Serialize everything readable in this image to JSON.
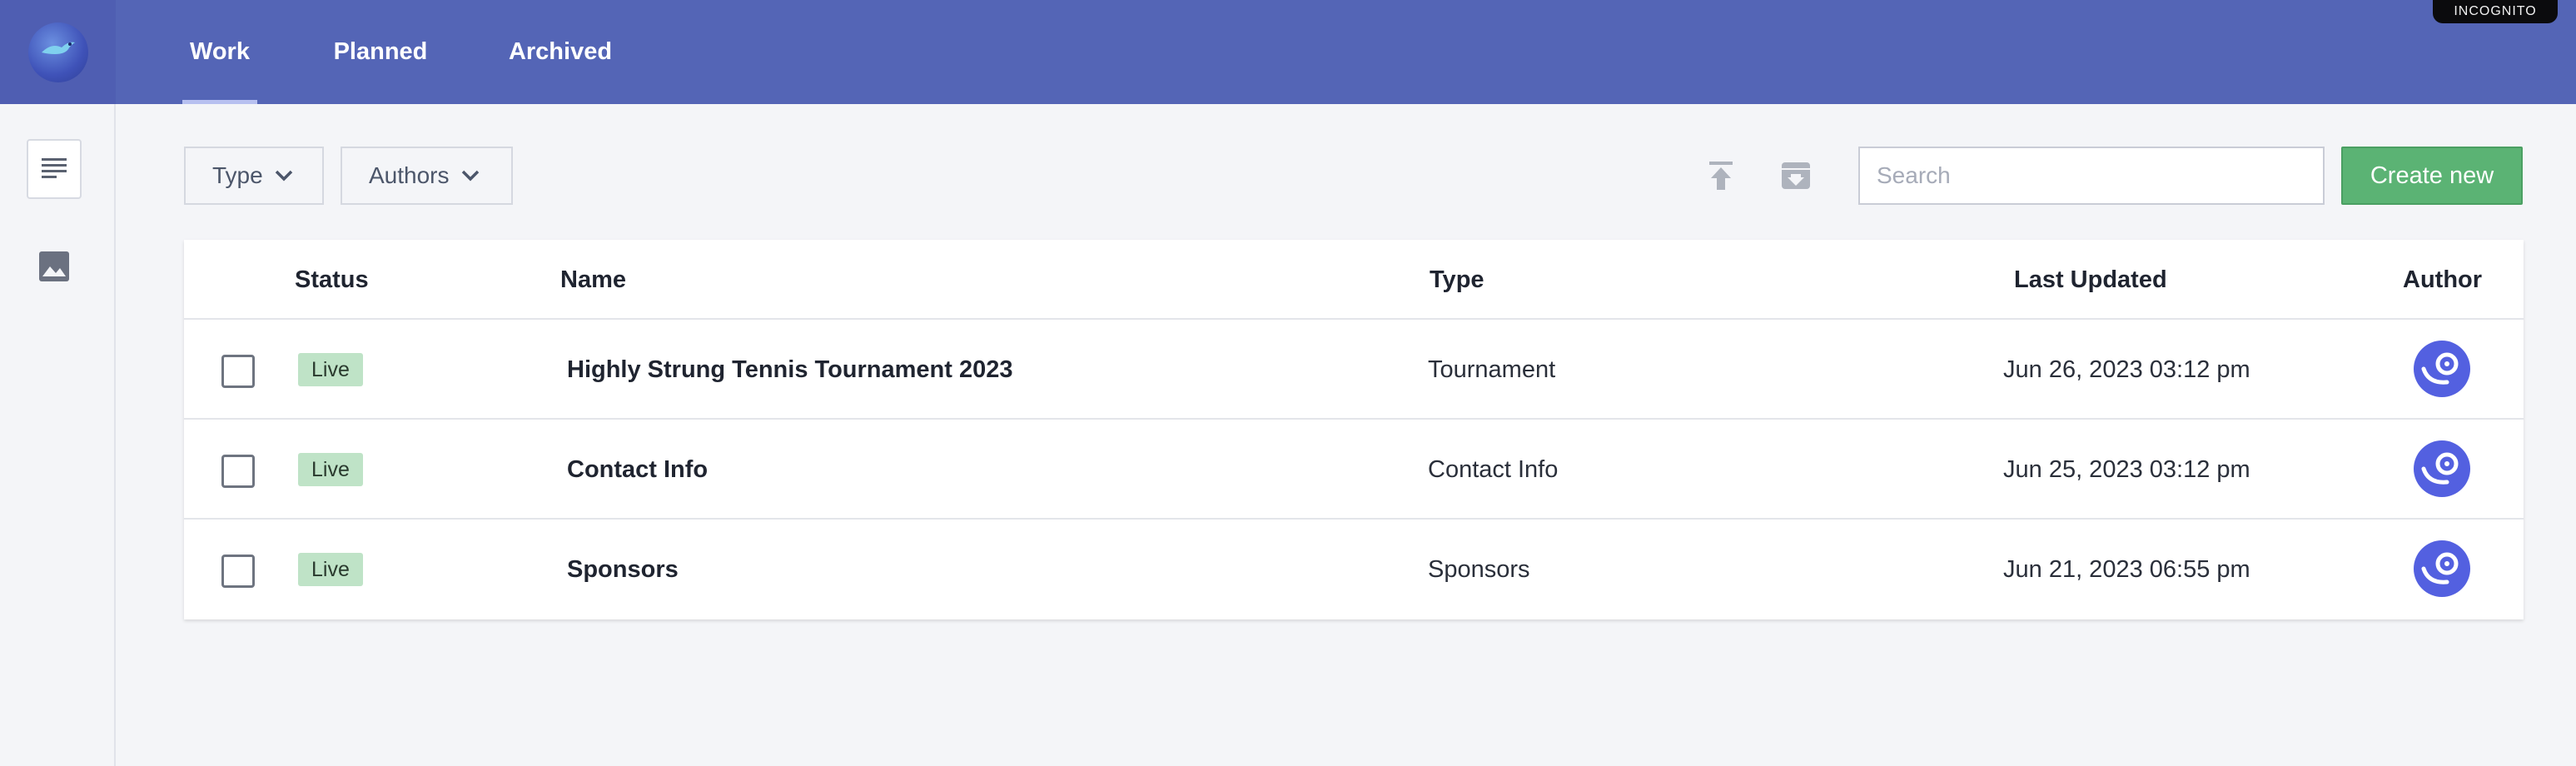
{
  "topbar": {
    "tabs": [
      {
        "label": "Work"
      },
      {
        "label": "Planned"
      },
      {
        "label": "Archived"
      }
    ],
    "badge": "INCOGNITO"
  },
  "sidebar": {
    "items": [
      {
        "icon": "document-list-icon"
      },
      {
        "icon": "image-icon"
      }
    ]
  },
  "toolbar": {
    "filters": [
      {
        "label": "Type"
      },
      {
        "label": "Authors"
      }
    ],
    "search_placeholder": "Search",
    "create_label": "Create new"
  },
  "table": {
    "columns": [
      "Status",
      "Name",
      "Type",
      "Last Updated",
      "Author"
    ],
    "rows": [
      {
        "status": "Live",
        "name": "Highly Strung Tennis Tournament 2023",
        "type": "Tournament",
        "updated": "Jun 26, 2023 03:12 pm"
      },
      {
        "status": "Live",
        "name": "Contact Info",
        "type": "Contact Info",
        "updated": "Jun 25, 2023 03:12 pm"
      },
      {
        "status": "Live",
        "name": "Sponsors",
        "type": "Sponsors",
        "updated": "Jun 21, 2023 06:55 pm"
      }
    ]
  },
  "colors": {
    "topbar": "#5465b6",
    "accent_green": "#5bb374",
    "live_badge": "#bfe3c7",
    "avatar": "#5360e0"
  }
}
